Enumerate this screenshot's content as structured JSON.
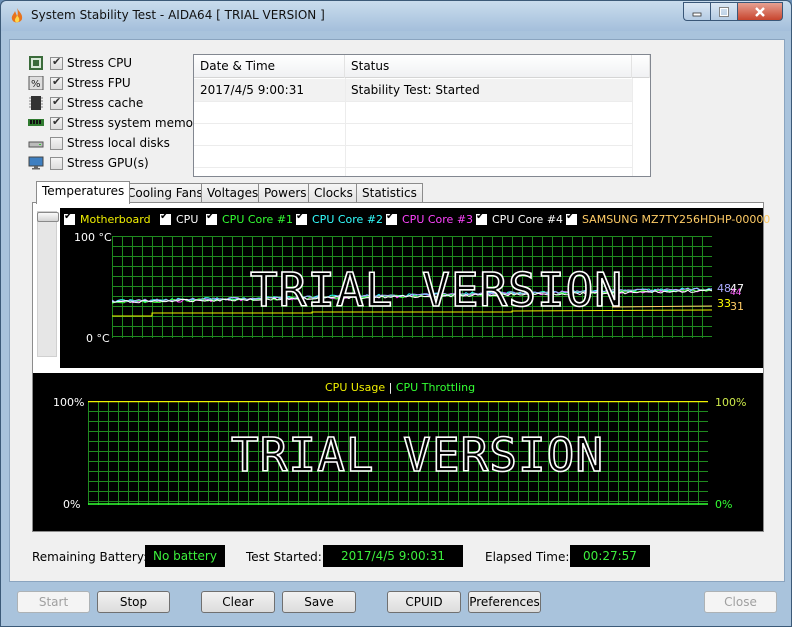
{
  "window": {
    "title": "System Stability Test - AIDA64  [ TRIAL VERSION ]"
  },
  "stress_options": [
    {
      "label": "Stress CPU",
      "checked": true,
      "icon": "cpu-chip-icon"
    },
    {
      "label": "Stress FPU",
      "checked": true,
      "icon": "fpu-percent-icon"
    },
    {
      "label": "Stress cache",
      "checked": true,
      "icon": "cache-chip-icon"
    },
    {
      "label": "Stress system memory",
      "checked": true,
      "icon": "memory-module-icon"
    },
    {
      "label": "Stress local disks",
      "checked": false,
      "icon": "disk-drive-icon"
    },
    {
      "label": "Stress GPU(s)",
      "checked": false,
      "icon": "monitor-gpu-icon"
    }
  ],
  "log": {
    "columns": [
      "Date & Time",
      "Status"
    ],
    "rows": [
      {
        "datetime": "2017/4/5 9:00:31",
        "status": "Stability Test: Started"
      }
    ]
  },
  "tabs": [
    "Temperatures",
    "Cooling Fans",
    "Voltages",
    "Powers",
    "Clocks",
    "Statistics"
  ],
  "active_tab": "Temperatures",
  "temperature_chart": {
    "legend": [
      {
        "name": "Motherboard",
        "color": "#f0f000"
      },
      {
        "name": "CPU",
        "color": "#ffffff"
      },
      {
        "name": "CPU Core #1",
        "color": "#33ff33"
      },
      {
        "name": "CPU Core #2",
        "color": "#33ffff"
      },
      {
        "name": "CPU Core #3",
        "color": "#ff44ff"
      },
      {
        "name": "CPU Core #4",
        "color": "#ffffff"
      },
      {
        "name": "SAMSUNG MZ7TY256HDHP-00000",
        "color": "#ffcc66"
      }
    ],
    "y_max_label": "100 °C",
    "y_min_label": "0 °C",
    "watermark": "TRIAL VERSION",
    "value_labels": [
      {
        "text": "48",
        "color": "#aaaaff"
      },
      {
        "text": "47",
        "color": "#ffffff"
      },
      {
        "text": "44",
        "color": "#ff66ff"
      },
      {
        "text": "33",
        "color": "#ffff00"
      },
      {
        "text": "31",
        "color": "#ffcc66"
      }
    ],
    "grid_color": "#1f8a1f"
  },
  "cpu_chart": {
    "legend_usage": "CPU Usage",
    "legend_sep": "|",
    "legend_throttling": "CPU Throttling",
    "left_max": "100%",
    "left_min": "0%",
    "right_max": "100%",
    "right_min": "0%",
    "watermark": "TRIAL VERSION",
    "usage_color": "#f0f000",
    "throttle_color": "#33ff33"
  },
  "status": {
    "battery_label": "Remaining Battery:",
    "battery_value": "No battery",
    "started_label": "Test Started:",
    "started_value": "2017/4/5 9:00:31",
    "elapsed_label": "Elapsed Time:",
    "elapsed_value": "00:27:57"
  },
  "buttons": {
    "start": "Start",
    "stop": "Stop",
    "clear": "Clear",
    "save": "Save",
    "cpuid": "CPUID",
    "preferences": "Preferences",
    "close": "Close"
  }
}
